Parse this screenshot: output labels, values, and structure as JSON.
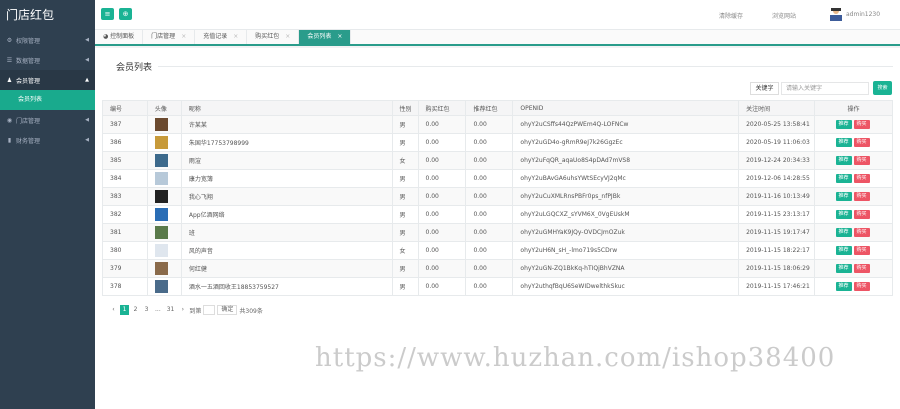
{
  "app": {
    "title": "门店红包"
  },
  "sidebar": {
    "items": [
      {
        "label": "权限管理",
        "icon": "gear-icon"
      },
      {
        "label": "数据管理",
        "icon": "list-icon"
      },
      {
        "label": "会员管理",
        "icon": "users-icon"
      },
      {
        "label": "门店管理",
        "icon": "circle-icon"
      },
      {
        "label": "财务管理",
        "icon": "bar-chart-icon"
      }
    ],
    "sub_item": "会员列表"
  },
  "header": {
    "links": [
      "清除缓存",
      "浏览网站"
    ],
    "user": "admin1230"
  },
  "tabs": [
    {
      "label": "控制面板",
      "active": false,
      "closable": false
    },
    {
      "label": "门店管理",
      "active": false,
      "closable": true
    },
    {
      "label": "充值记录",
      "active": false,
      "closable": true
    },
    {
      "label": "购买红包",
      "active": false,
      "closable": true
    },
    {
      "label": "会员列表",
      "active": true,
      "closable": true
    }
  ],
  "main": {
    "title": "会员列表",
    "keyword_label": "关键字",
    "search_placeholder": "请输入关键字",
    "search_button": "搜索",
    "columns": [
      "编号",
      "头像",
      "昵称",
      "性别",
      "购买红包",
      "推荐红包",
      "OPENID",
      "关注时间",
      "操作"
    ],
    "rows": [
      {
        "id": "387",
        "name": "许某某",
        "gender": "男",
        "buy": "0.00",
        "rec": "0.00",
        "openid": "ohyY2uCSffs44QzPWEm4Q-LOFNCw",
        "time": "2020-05-25 13:58:41",
        "avatar_color": "#6b4a2f"
      },
      {
        "id": "386",
        "name": "朱国华17753798999",
        "gender": "男",
        "buy": "0.00",
        "rec": "0.00",
        "openid": "ohyY2uGD4o-gRmR9eJ7k26GgzEc",
        "time": "2020-05-19 11:06:03",
        "avatar_color": "#c79a3a"
      },
      {
        "id": "385",
        "name": "雨渲",
        "gender": "女",
        "buy": "0.00",
        "rec": "0.00",
        "openid": "ohyY2uFqQR_aqaUo8S4pDAd7mVS8",
        "time": "2019-12-24 20:34:33",
        "avatar_color": "#3d6a8c"
      },
      {
        "id": "384",
        "name": "康力宽簿",
        "gender": "男",
        "buy": "0.00",
        "rec": "0.00",
        "openid": "ohyY2uBAvGA6uhsYWtSEcyVJ2qMc",
        "time": "2019-12-06 14:28:55",
        "avatar_color": "#b7c9d9"
      },
      {
        "id": "383",
        "name": "我心飞翔",
        "gender": "男",
        "buy": "0.00",
        "rec": "0.00",
        "openid": "ohyY2uCuXMLRnsPBFr0ps_nfPJBk",
        "time": "2019-11-16 10:13:49",
        "avatar_color": "#222222"
      },
      {
        "id": "382",
        "name": "App亿酒网络",
        "gender": "男",
        "buy": "0.00",
        "rec": "0.00",
        "openid": "ohyY2uLGQCXZ_sYVM6X_0VgEUskM",
        "time": "2019-11-15 23:13:17",
        "avatar_color": "#2a6db5"
      },
      {
        "id": "381",
        "name": "班",
        "gender": "男",
        "buy": "0.00",
        "rec": "0.00",
        "openid": "ohyY2uGMHYaK9JQy-OVDCJmOZuk",
        "time": "2019-11-15 19:17:47",
        "avatar_color": "#5a7a4a"
      },
      {
        "id": "380",
        "name": "风的声音",
        "gender": "女",
        "buy": "0.00",
        "rec": "0.00",
        "openid": "ohyY2uH6N_sH_-lmo719s5CDrw",
        "time": "2019-11-15 18:22:17",
        "avatar_color": "#dfe6ee"
      },
      {
        "id": "379",
        "name": "何红健",
        "gender": "男",
        "buy": "0.00",
        "rec": "0.00",
        "openid": "ohyY2uGN-ZQ1BkKq-hTIQjBhVZNA",
        "time": "2019-11-15 18:06:29",
        "avatar_color": "#8a6a4a"
      },
      {
        "id": "378",
        "name": "酒水一五酒回收王18853759527",
        "gender": "男",
        "buy": "0.00",
        "rec": "0.00",
        "openid": "ohyY2uthqfBqU6SeWIDwelthkSkuc",
        "time": "2019-11-15 17:46:21",
        "avatar_color": "#4a6b8a"
      }
    ],
    "actions": [
      "推荐",
      "购买"
    ]
  },
  "pagination": {
    "pages": [
      "1",
      "2",
      "3",
      "...",
      "31"
    ],
    "current": "1",
    "jump_label": "到第",
    "go_label": "确定",
    "total": "共309条"
  },
  "watermark": "https://www.huzhan.com/ishop38400",
  "colors": {
    "accent": "#1ab394",
    "sidebar": "#2f4050",
    "danger": "#ed5565"
  }
}
